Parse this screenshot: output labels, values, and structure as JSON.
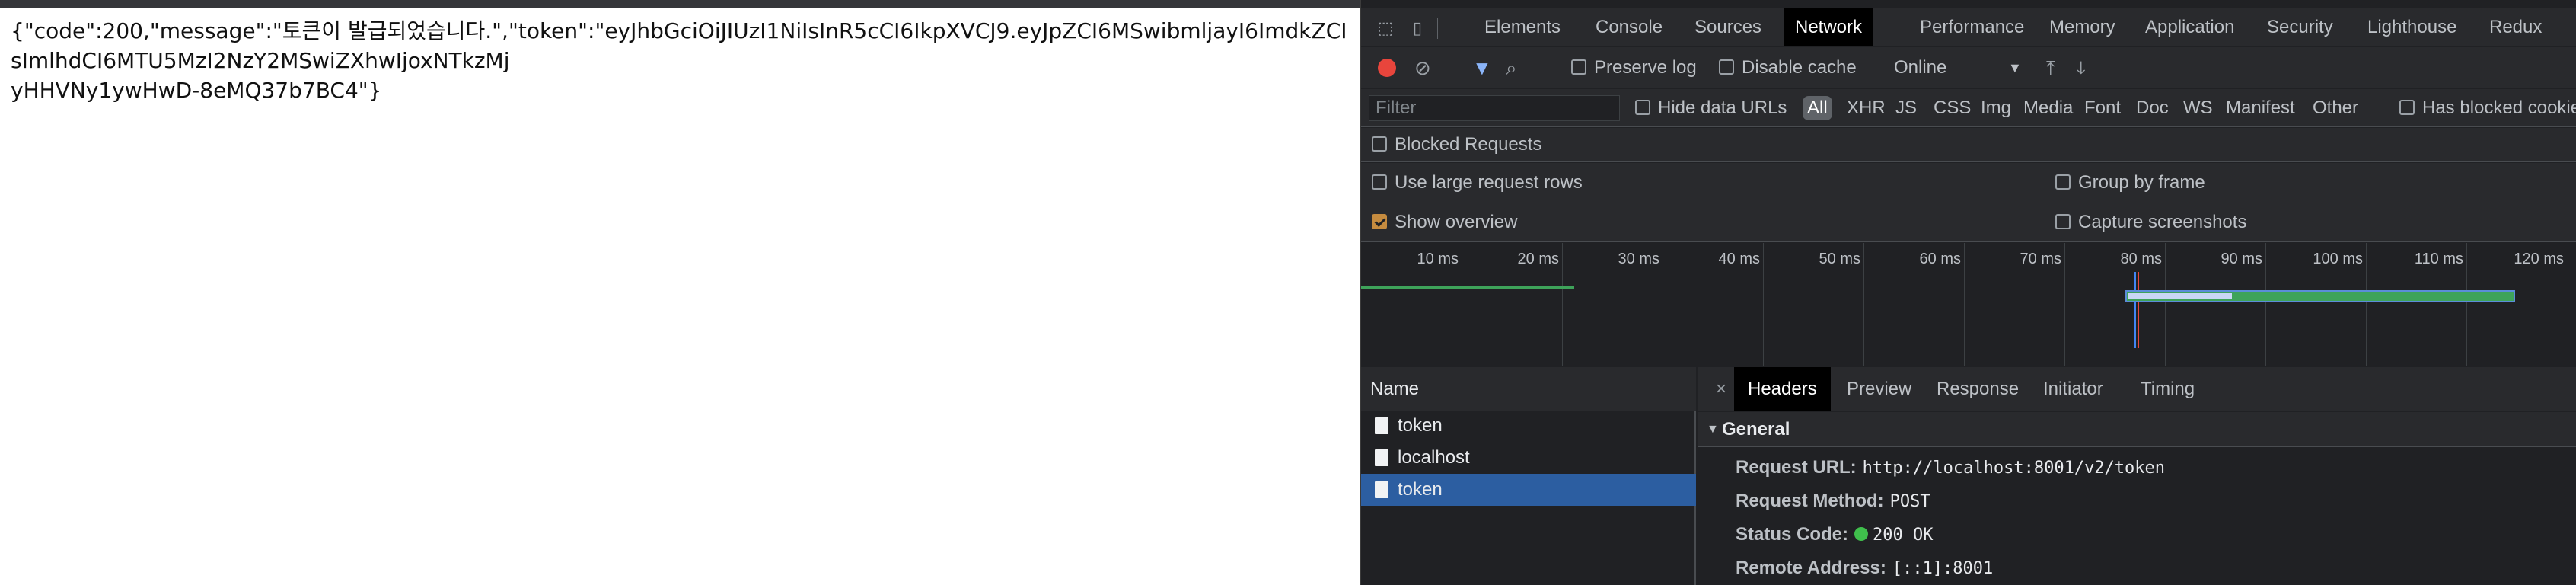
{
  "page": {
    "json_text": "{\"code\":200,\"message\":\"토큰이 발급되었습니다.\",\"token\":\"eyJhbGciOiJIUzI1NiIsInR5cCI6IkpXVCJ9.eyJpZCI6MSwibmljayI6ImdkZCIsImlhdCI6MTU5MzI2NzY2MSwiZXhwIjoxNTkzMj",
    "json_tail": "yHHVNy1ywHwD-8eMQ37b7BC4\"}"
  },
  "devtools": {
    "tabs": [
      "Elements",
      "Console",
      "Sources",
      "Network",
      "Performance",
      "Memory",
      "Application",
      "Security",
      "Lighthouse",
      "Redux"
    ],
    "active_tab": "Network",
    "toolbar": {
      "preserve_log": "Preserve log",
      "disable_cache": "Disable cache",
      "throttle": "Online"
    },
    "filter": {
      "placeholder": "Filter",
      "hide_data_urls": "Hide data URLs",
      "types": [
        "All",
        "XHR",
        "JS",
        "CSS",
        "Img",
        "Media",
        "Font",
        "Doc",
        "WS",
        "Manifest",
        "Other"
      ],
      "has_blocked_cookies": "Has blocked cookies"
    },
    "blocked_requests": "Blocked Requests",
    "options": {
      "large_rows": "Use large request rows",
      "group_by_frame": "Group by frame",
      "show_overview": "Show overview",
      "capture_screenshots": "Capture screenshots"
    },
    "overview": {
      "ticks": [
        "10 ms",
        "20 ms",
        "30 ms",
        "40 ms",
        "50 ms",
        "60 ms",
        "70 ms",
        "80 ms",
        "90 ms",
        "100 ms",
        "110 ms",
        "120 ms"
      ]
    },
    "requests": {
      "header": "Name",
      "items": [
        "token",
        "localhost",
        "token"
      ]
    },
    "detail": {
      "tabs": [
        "Headers",
        "Preview",
        "Response",
        "Initiator",
        "Timing"
      ],
      "active_tab": "Headers",
      "section": "General",
      "fields": [
        {
          "key": "Request URL:",
          "value": "http://localhost:8001/v2/token"
        },
        {
          "key": "Request Method:",
          "value": "POST"
        },
        {
          "key": "Status Code:",
          "value": "200 OK"
        },
        {
          "key": "Remote Address:",
          "value": "[::1]:8001"
        }
      ]
    }
  }
}
